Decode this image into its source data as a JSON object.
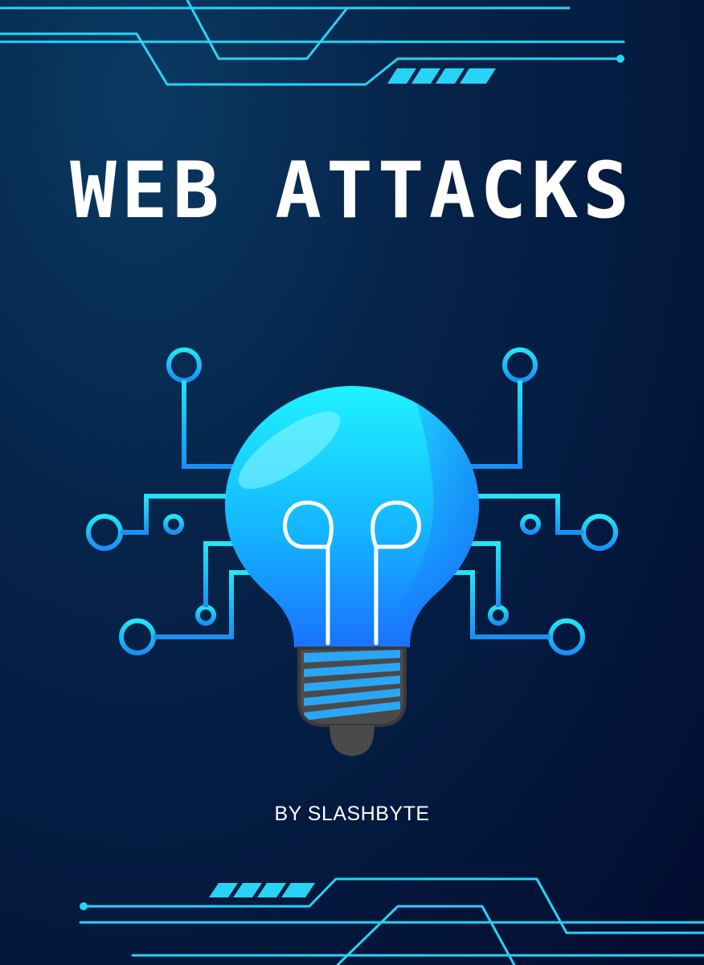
{
  "cover": {
    "title": "WEB ATTACKS",
    "author": "BY SLASHBYTE"
  },
  "colors": {
    "background_dark": "#020c2e",
    "background_mid": "#06244a",
    "circuit_cyan": "#29d3f5",
    "bulb_light": "#1fe0ff",
    "bulb_dark": "#1a7dff",
    "base_gray": "#4a4a4a",
    "text": "#ffffff"
  },
  "icons": {
    "main": "lightbulb-circuit-icon",
    "top_decoration": "circuit-lines",
    "bottom_decoration": "circuit-lines"
  }
}
